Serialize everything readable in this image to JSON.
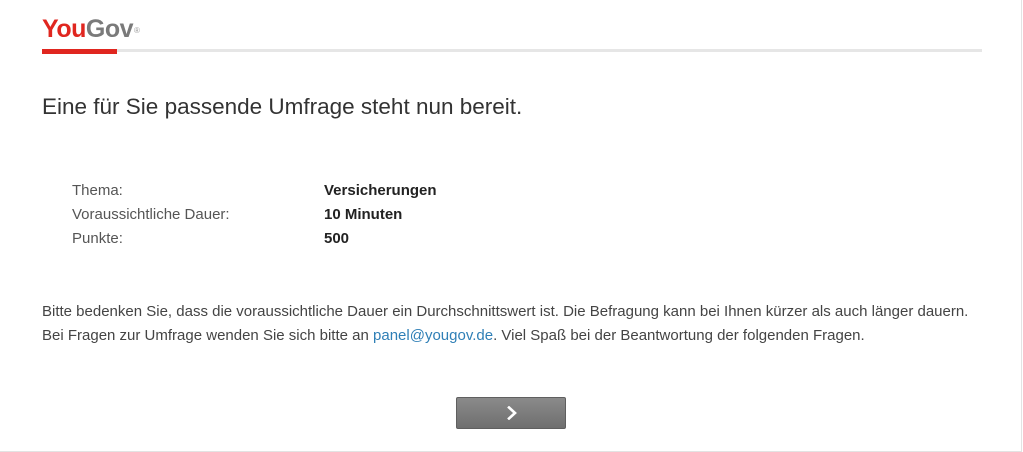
{
  "brand": {
    "logo_part1": "You",
    "logo_part2": "Gov",
    "logo_reg": "®"
  },
  "progress": {
    "fraction": 0.08
  },
  "headline": "Eine für Sie passende Umfrage steht nun bereit.",
  "survey_info": [
    {
      "label": "Thema:",
      "value": "Versicherungen"
    },
    {
      "label": "Voraussichtliche Dauer:",
      "value": "10 Minuten"
    },
    {
      "label": "Punkte:",
      "value": "500"
    }
  ],
  "note": {
    "text_before_link": "Bitte bedenken Sie, dass die voraussichtliche Dauer ein Durchschnittswert ist. Die Befragung kann bei Ihnen kürzer als auch länger dauern. Bei Fragen zur Umfrage wenden Sie sich bitte an ",
    "link_text": "panel@yougov.de",
    "text_after_link": ". Viel Spaß bei der Beantwortung der folgenden Fragen."
  },
  "next_button": {
    "icon": "chevron-right-icon"
  },
  "colors": {
    "brand_red": "#e0261f",
    "link_blue": "#2f7fb6",
    "button_gray": "#7d7d7d"
  }
}
